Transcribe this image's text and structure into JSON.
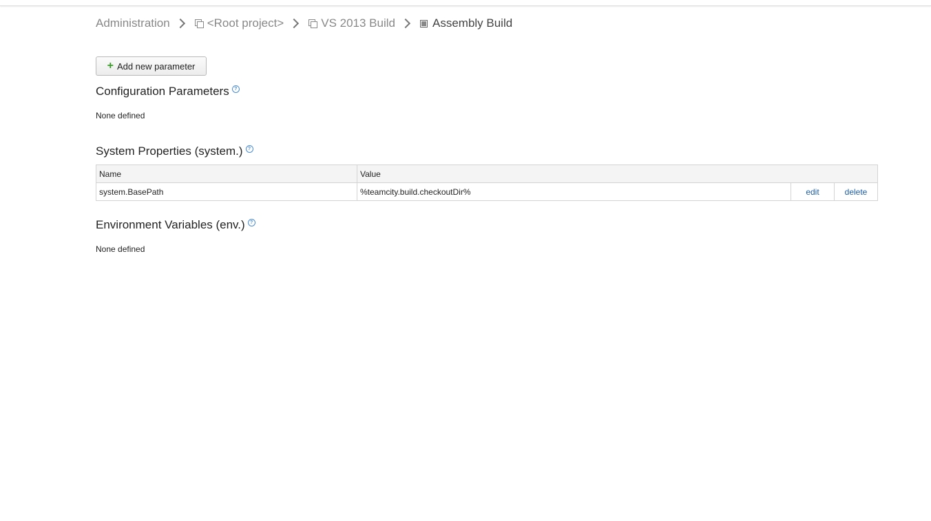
{
  "breadcrumb": {
    "administration": "Administration",
    "root_project": "<Root project>",
    "project": "VS 2013 Build",
    "build_config": "Assembly Build"
  },
  "toolbar": {
    "add_label": "Add new parameter"
  },
  "sections": {
    "config": {
      "title": "Configuration Parameters",
      "empty": "None defined"
    },
    "system": {
      "title": "System Properties (system.)",
      "columns": {
        "name": "Name",
        "value": "Value"
      },
      "rows": [
        {
          "name": "system.BasePath",
          "value": "%teamcity.build.checkoutDir%",
          "edit": "edit",
          "delete": "delete"
        }
      ]
    },
    "env": {
      "title": "Environment Variables (env.)",
      "empty": "None defined"
    }
  },
  "colors": {
    "link": "#1d5ea8",
    "plus": "#3a9a2a",
    "help": "#4a8ccf"
  }
}
